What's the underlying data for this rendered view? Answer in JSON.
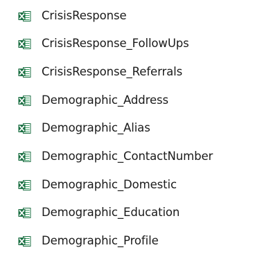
{
  "files": [
    {
      "name": "CrisisResponse",
      "icon": "excel-file-icon"
    },
    {
      "name": "CrisisResponse_FollowUps",
      "icon": "excel-file-icon"
    },
    {
      "name": "CrisisResponse_Referrals",
      "icon": "excel-file-icon"
    },
    {
      "name": "Demographic_Address",
      "icon": "excel-file-icon"
    },
    {
      "name": "Demographic_Alias",
      "icon": "excel-file-icon"
    },
    {
      "name": "Demographic_ContactNumber",
      "icon": "excel-file-icon"
    },
    {
      "name": "Demographic_Domestic",
      "icon": "excel-file-icon"
    },
    {
      "name": "Demographic_Education",
      "icon": "excel-file-icon"
    },
    {
      "name": "Demographic_Profile",
      "icon": "excel-file-icon"
    }
  ],
  "colors": {
    "excel_green": "#1d7044",
    "excel_green_light": "#2f9a5c",
    "sheet_white": "#ffffff",
    "text": "#1a1a1a"
  }
}
